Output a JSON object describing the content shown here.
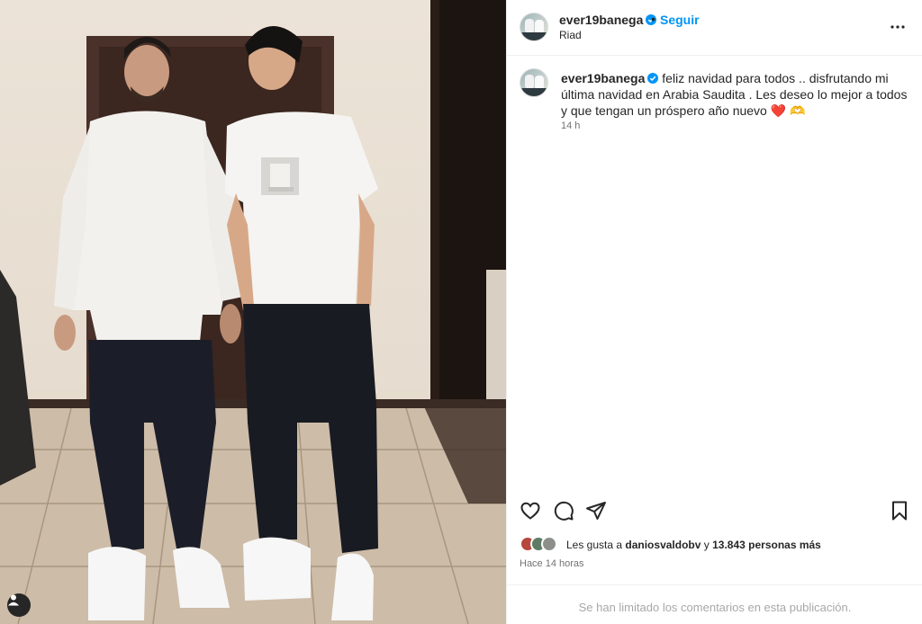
{
  "post": {
    "username": "ever19banega",
    "location": "Riad",
    "follow_label": "Seguir",
    "separator": "•",
    "caption": "feliz navidad para todos .. disfrutando mi última navidad en Arabia Saudita . Les deseo lo mejor a todos y que tengan un próspero año nuevo",
    "caption_emojis": "❤️ 🫶",
    "caption_time": "14 h",
    "likes_prefix": "Les gusta a",
    "likes_user": "daniosvaldobv",
    "likes_middle": "y",
    "likes_count": "13.843 personas más",
    "post_time": "Hace 14 horas",
    "comments_notice": "Se han limitado los comentarios en esta publicación."
  },
  "icons": {
    "more": "more-horizontal-icon",
    "like": "heart-icon",
    "comment": "comment-icon",
    "share": "send-icon",
    "save": "bookmark-icon",
    "verified": "verified-badge-icon",
    "tagged": "user-tag-icon"
  },
  "colors": {
    "link": "#0095f6",
    "verified": "#0095f6",
    "muted": "#737373",
    "text": "#262626"
  }
}
